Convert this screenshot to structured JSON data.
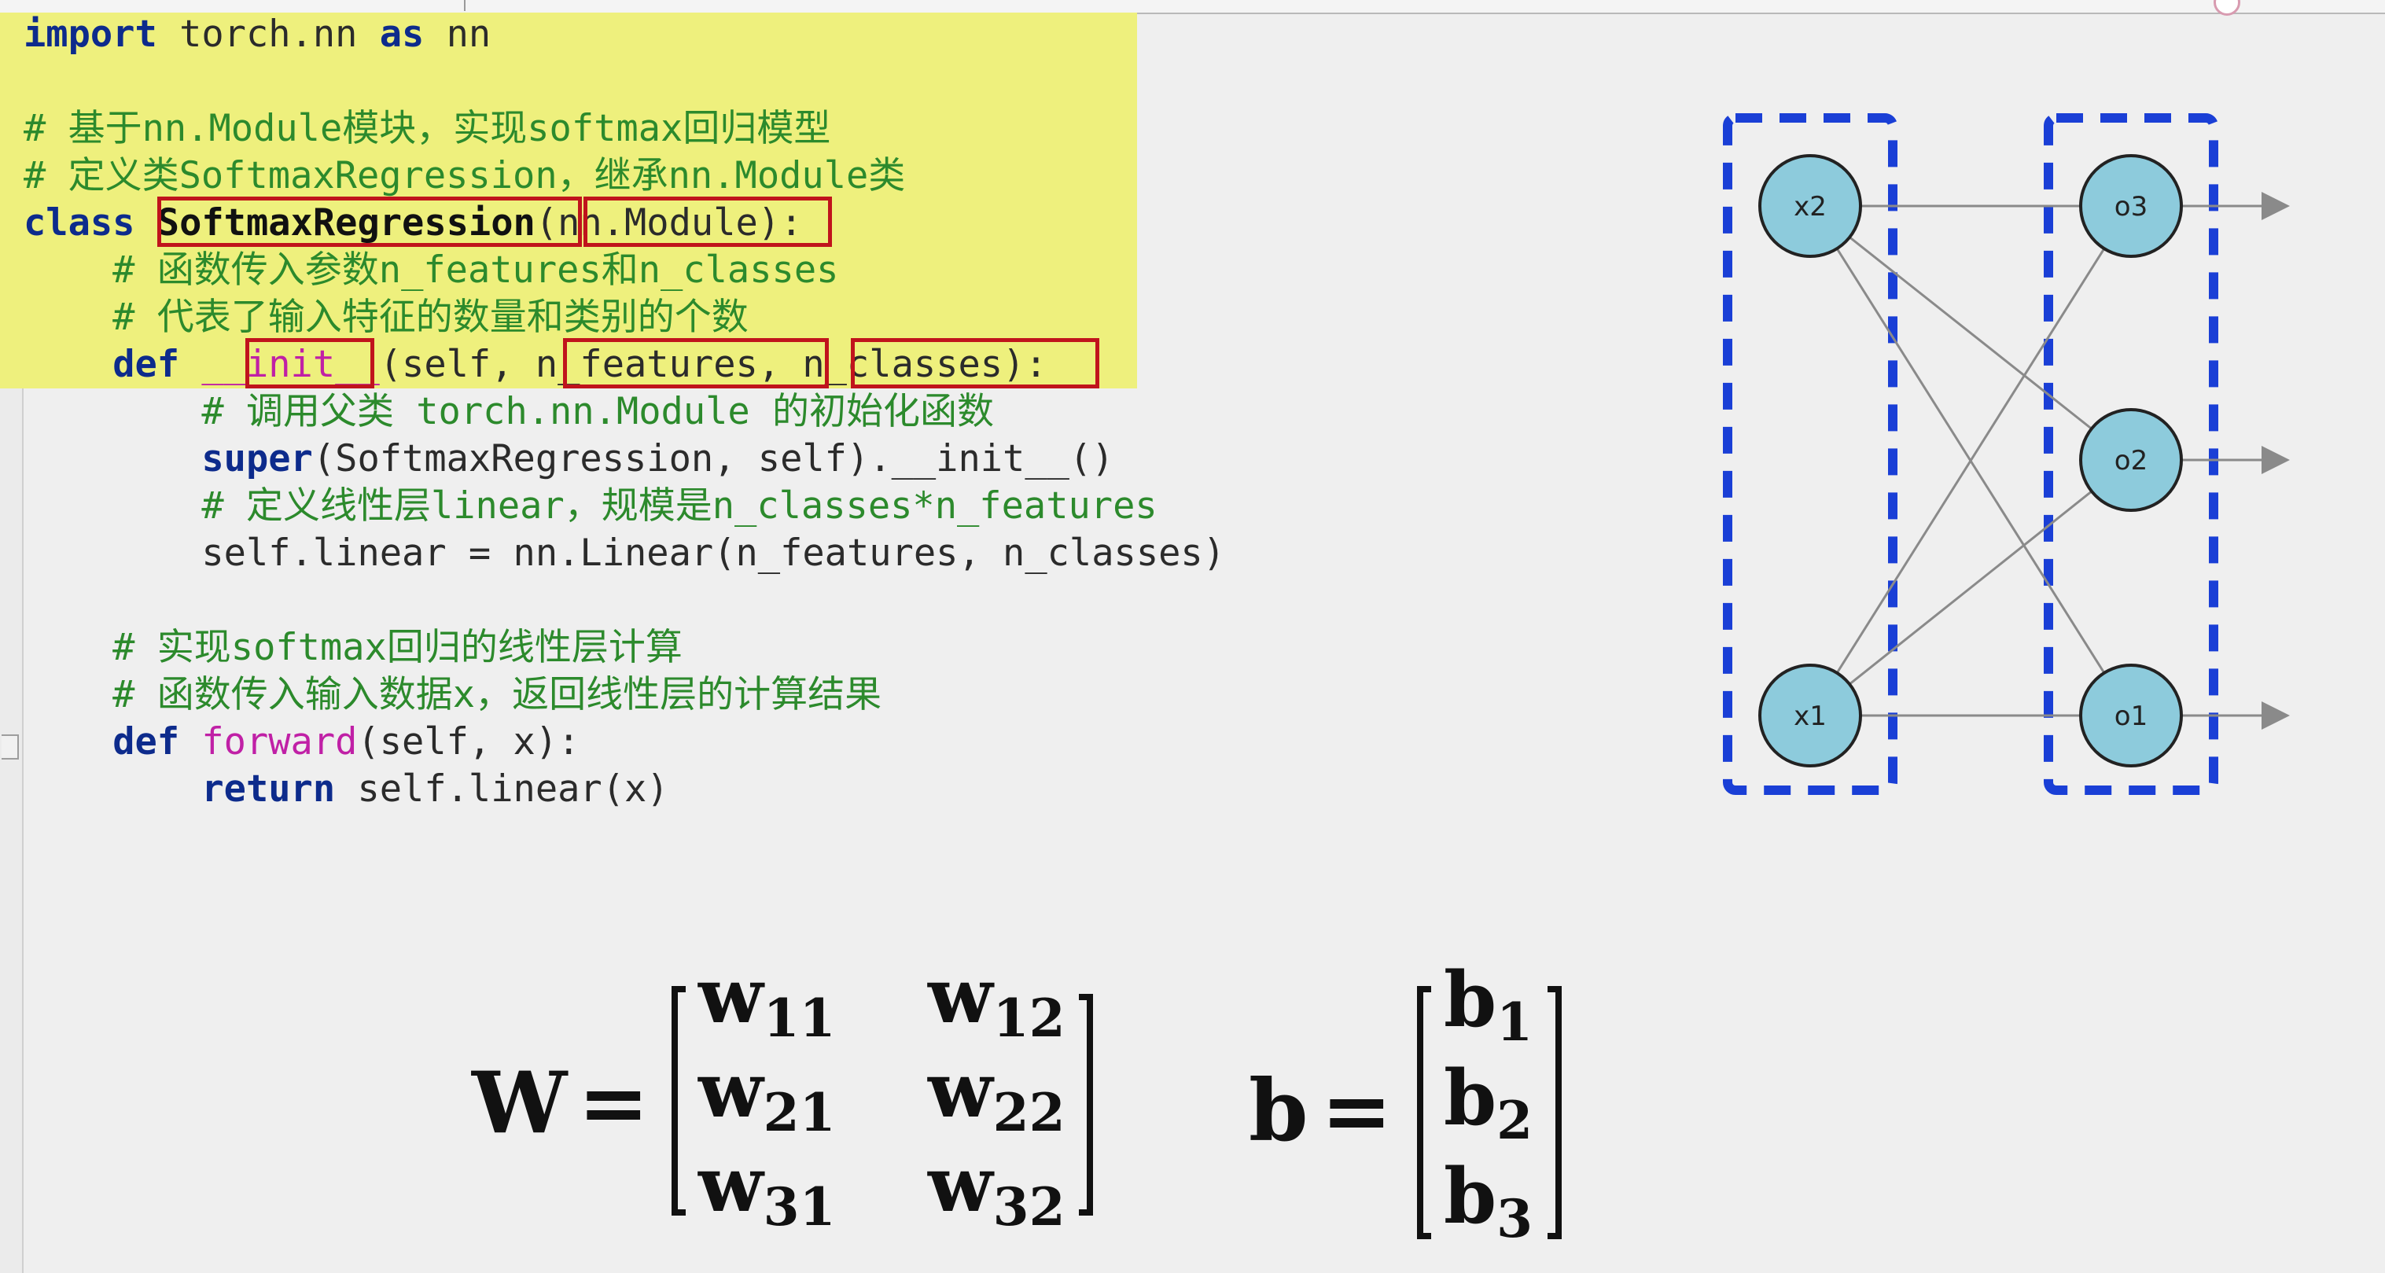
{
  "code": {
    "lines": [
      {
        "parts": [
          {
            "t": "import",
            "c": "kw"
          },
          {
            "t": " torch.nn ",
            "c": "tx"
          },
          {
            "t": "as",
            "c": "kw"
          },
          {
            "t": " nn",
            "c": "tx"
          }
        ]
      },
      {
        "parts": []
      },
      {
        "parts": [
          {
            "t": "# 基于nn.Module模块，实现softmax回归模型",
            "c": "cm"
          }
        ]
      },
      {
        "parts": [
          {
            "t": "# 定义类SoftmaxRegression，继承nn.Module类",
            "c": "cm"
          }
        ]
      },
      {
        "parts": [
          {
            "t": "class",
            "c": "kw"
          },
          {
            "t": " ",
            "c": "tx"
          },
          {
            "t": "SoftmaxRegression",
            "c": "cls-name"
          },
          {
            "t": "(nn.Module):",
            "c": "tx"
          }
        ]
      },
      {
        "parts": [
          {
            "t": "    # 函数传入参数n_features和n_classes",
            "c": "cm"
          }
        ]
      },
      {
        "parts": [
          {
            "t": "    # 代表了输入特征的数量和类别的个数",
            "c": "cm"
          }
        ]
      },
      {
        "parts": [
          {
            "t": "    ",
            "c": "tx"
          },
          {
            "t": "def",
            "c": "kw"
          },
          {
            "t": " ",
            "c": "tx"
          },
          {
            "t": "__init__",
            "c": "fn"
          },
          {
            "t": "(self, n_features, n_classes):",
            "c": "tx"
          }
        ]
      },
      {
        "parts": [
          {
            "t": "        # 调用父类 torch.nn.Module 的初始化函数",
            "c": "cm"
          }
        ]
      },
      {
        "parts": [
          {
            "t": "        ",
            "c": "tx"
          },
          {
            "t": "super",
            "c": "kw"
          },
          {
            "t": "(SoftmaxRegression, self).__init__()",
            "c": "tx"
          }
        ]
      },
      {
        "parts": [
          {
            "t": "        # 定义线性层linear，规模是n_classes*n_features",
            "c": "cm"
          }
        ]
      },
      {
        "parts": [
          {
            "t": "        self.linear = nn.Linear(n_features, n_classes)",
            "c": "tx"
          }
        ]
      },
      {
        "parts": []
      },
      {
        "parts": [
          {
            "t": "    # 实现softmax回归的线性层计算",
            "c": "cm"
          }
        ]
      },
      {
        "parts": [
          {
            "t": "    # 函数传入输入数据x，返回线性层的计算结果",
            "c": "cm"
          }
        ]
      },
      {
        "parts": [
          {
            "t": "    ",
            "c": "tx"
          },
          {
            "t": "def",
            "c": "kw"
          },
          {
            "t": " ",
            "c": "tx"
          },
          {
            "t": "forward",
            "c": "fn"
          },
          {
            "t": "(self, x):",
            "c": "tx"
          }
        ]
      },
      {
        "parts": [
          {
            "t": "        ",
            "c": "tx"
          },
          {
            "t": "return",
            "c": "kw"
          },
          {
            "t": " self.linear(x)",
            "c": "tx"
          }
        ]
      }
    ]
  },
  "network": {
    "input_nodes": [
      "x2",
      "x1"
    ],
    "output_nodes": [
      "o3",
      "o2",
      "o1"
    ]
  },
  "formula": {
    "W_symbol": "W",
    "b_symbol": "b",
    "equals": "=",
    "weight_base": "w",
    "bias_base": "b",
    "weights": [
      [
        "11",
        "12"
      ],
      [
        "21",
        "22"
      ],
      [
        "31",
        "32"
      ]
    ],
    "biases": [
      "1",
      "2",
      "3"
    ]
  },
  "colors": {
    "highlight": "#eef07d",
    "annotation_box": "#c0141c",
    "node_fill": "#8dcbdc",
    "group_dash": "#1a3fd6",
    "keyword": "#0d2b8c",
    "comment": "#2c8a2c",
    "function_name": "#c020a6"
  }
}
